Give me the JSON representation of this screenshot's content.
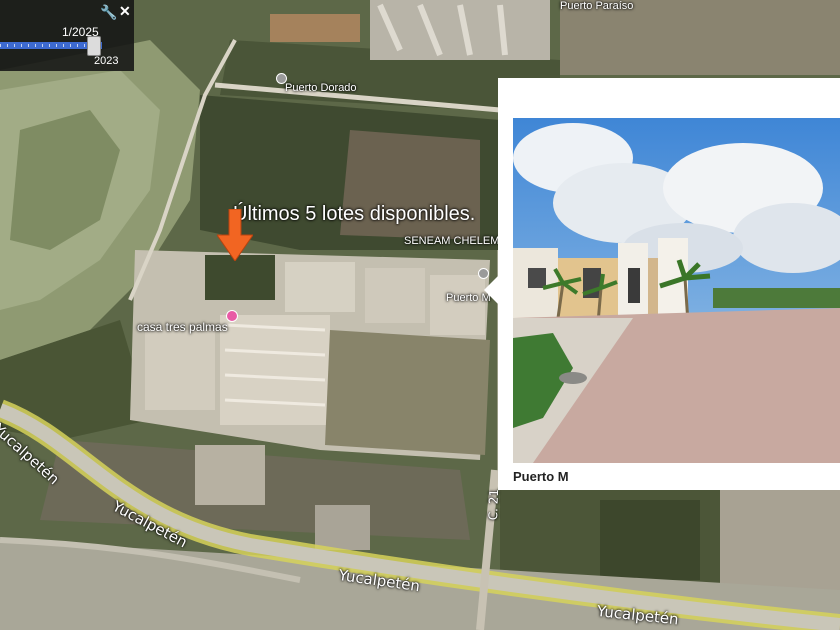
{
  "time_slider": {
    "date_label": "1/2025",
    "year_label": "2023",
    "wrench_icon": "wrench-icon",
    "close_icon": "close-icon",
    "position": 0.87
  },
  "map": {
    "headline": "Últimos 5 lotes disponibles.",
    "places": {
      "puerto_dorado": "Puerto Dorado",
      "seneam": "SENEAM CHELEM",
      "casa_tres_palmas": "casa tres palmas",
      "puerto_top": "Puerto Paraíso",
      "puerto_right": "Puerto M"
    },
    "roads": {
      "yuc1": "Yucalpetén",
      "yuc2": "Yucalpetén",
      "yuc3": "Yucalpetén",
      "yuc4": "Yucalpetén",
      "c21": "C. 21"
    },
    "colors": {
      "arrow": "#f26522",
      "pin": "#e85aa5"
    }
  },
  "popup": {
    "caption": "Puerto M",
    "photo_icon": "street-photo"
  }
}
